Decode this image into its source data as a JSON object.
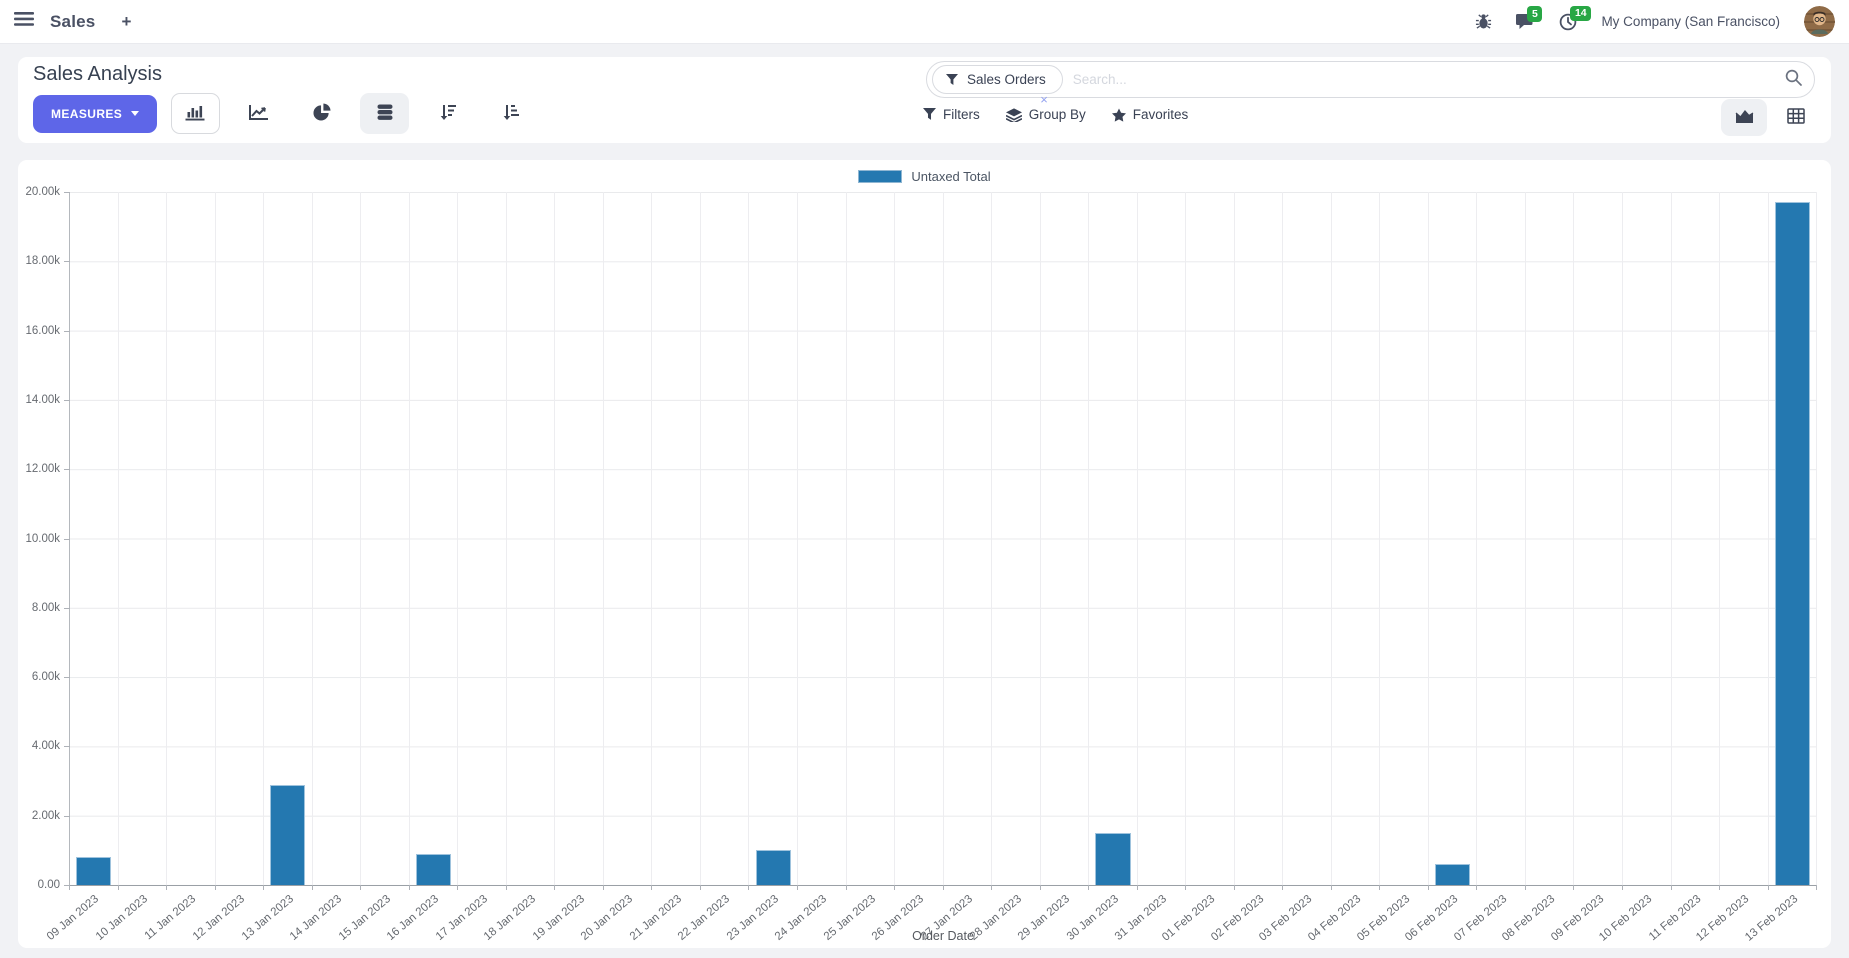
{
  "navbar": {
    "app_name": "Sales",
    "plus_label": "+",
    "messages_badge": "5",
    "activities_badge": "14",
    "company": "My Company (San Francisco)"
  },
  "control_panel": {
    "title": "Sales Analysis",
    "measures_label": "MEASURES",
    "search": {
      "facet_label": "Sales Orders",
      "facet_remove_label": "×",
      "placeholder": "Search..."
    },
    "filters_label": "Filters",
    "group_by_label": "Group By",
    "favorites_label": "Favorites"
  },
  "colors": {
    "accent": "#5e66e8",
    "bar": "#2478b0",
    "badge_green": "#28a745"
  },
  "chart_data": {
    "type": "bar",
    "title": "",
    "legend": [
      "Untaxed Total"
    ],
    "legend_position": "top",
    "grid": true,
    "xlabel": "Order Date",
    "ylabel": "",
    "ylim": [
      0,
      20000
    ],
    "y_ticks": [
      "20.00k",
      "18.00k",
      "16.00k",
      "14.00k",
      "12.00k",
      "10.00k",
      "8.00k",
      "6.00k",
      "4.00k",
      "2.00k",
      "0.00"
    ],
    "categories": [
      "09 Jan 2023",
      "10 Jan 2023",
      "11 Jan 2023",
      "12 Jan 2023",
      "13 Jan 2023",
      "14 Jan 2023",
      "15 Jan 2023",
      "16 Jan 2023",
      "17 Jan 2023",
      "18 Jan 2023",
      "19 Jan 2023",
      "20 Jan 2023",
      "21 Jan 2023",
      "22 Jan 2023",
      "23 Jan 2023",
      "24 Jan 2023",
      "25 Jan 2023",
      "26 Jan 2023",
      "27 Jan 2023",
      "28 Jan 2023",
      "29 Jan 2023",
      "30 Jan 2023",
      "31 Jan 2023",
      "01 Feb 2023",
      "02 Feb 2023",
      "03 Feb 2023",
      "04 Feb 2023",
      "05 Feb 2023",
      "06 Feb 2023",
      "07 Feb 2023",
      "08 Feb 2023",
      "09 Feb 2023",
      "10 Feb 2023",
      "11 Feb 2023",
      "12 Feb 2023",
      "13 Feb 2023"
    ],
    "series": [
      {
        "name": "Untaxed Total",
        "color": "#2478b0",
        "values": [
          800,
          0,
          0,
          0,
          2900,
          0,
          0,
          900,
          0,
          0,
          0,
          0,
          0,
          0,
          1000,
          0,
          0,
          0,
          0,
          0,
          0,
          1500,
          0,
          0,
          0,
          0,
          0,
          0,
          600,
          0,
          0,
          0,
          0,
          0,
          0,
          19700
        ]
      }
    ]
  }
}
